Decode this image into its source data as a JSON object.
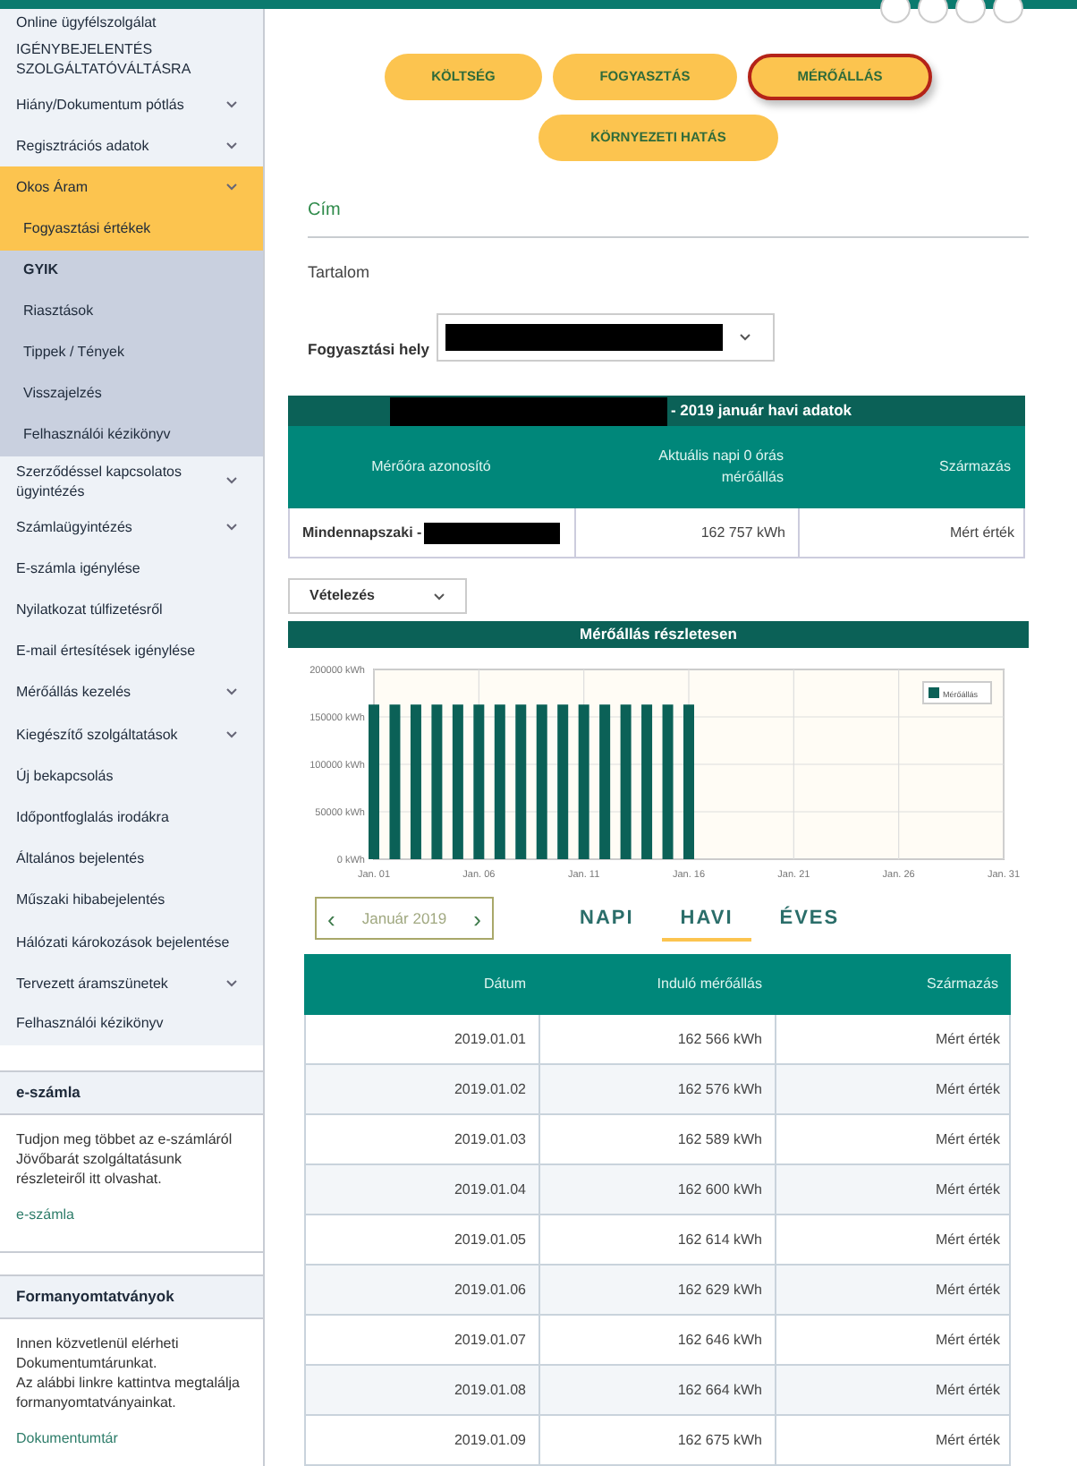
{
  "sidebar": {
    "items": [
      {
        "label": "Online ügyfélszolgálat",
        "expandable": false
      },
      {
        "label": "IGÉNYBEJELENTÉS SZOLGÁLTATÓVÁLTÁSRA",
        "expandable": false
      },
      {
        "label": "Hiány/Dokumentum pótlás",
        "expandable": true
      },
      {
        "label": "Regisztrációs adatok",
        "expandable": true
      },
      {
        "label": "Okos Áram",
        "expandable": true,
        "expanded": true,
        "children": [
          {
            "label": "Fogyasztási értékek",
            "selected": true,
            "bold": false
          },
          {
            "label": "GYIK",
            "selected": false,
            "bold": true
          },
          {
            "label": "Riasztások",
            "selected": false,
            "bold": false
          },
          {
            "label": "Tippek / Tények",
            "selected": false,
            "bold": false
          },
          {
            "label": "Visszajelzés",
            "selected": false,
            "bold": false
          },
          {
            "label": "Felhasználói kézikönyv",
            "selected": false,
            "bold": false
          }
        ]
      },
      {
        "label": "Szerződéssel kapcsolatos ügyintézés",
        "expandable": true
      },
      {
        "label": "Számlaügyintézés",
        "expandable": true
      },
      {
        "label": "E-számla igénylése",
        "expandable": false
      },
      {
        "label": "Nyilatkozat túlfizetésről",
        "expandable": false
      },
      {
        "label": "E-mail értesítések igénylése",
        "expandable": false
      },
      {
        "label": "Mérőállás kezelés",
        "expandable": true
      },
      {
        "label": "Kiegészítő szolgáltatások",
        "expandable": true
      },
      {
        "label": "Új bekapcsolás",
        "expandable": false
      },
      {
        "label": "Időpontfoglalás irodákra",
        "expandable": false
      },
      {
        "label": "Általános bejelentés",
        "expandable": false
      },
      {
        "label": "Műszaki hibabejelentés",
        "expandable": false
      },
      {
        "label": "Hálózati károkozások bejelentése",
        "expandable": false
      },
      {
        "label": "Tervezett áramszünetek",
        "expandable": true
      },
      {
        "label": "Felhasználói kézikönyv",
        "expandable": false
      }
    ],
    "boxes": [
      {
        "title": "e-számla",
        "text": [
          "Tudjon meg többet az e-számláról Jövőbarát szolgáltatásunk részleteiről itt olvashat."
        ],
        "link": "e-számla"
      },
      {
        "title": "Formanyomtatványok",
        "text": [
          "Innen közvetlenül elérheti Dokumentumtárunkat.",
          "Az alábbi linkre kattintva megtalálja formanyomtatványainkat."
        ],
        "link": "Dokumentumtár"
      }
    ]
  },
  "view_tabs": [
    {
      "label": "KÖLTSÉG",
      "selected": false
    },
    {
      "label": "FOGYASZTÁS",
      "selected": false
    },
    {
      "label": "MÉRŐÁLLÁS",
      "selected": true
    },
    {
      "label": "KÖRNYEZETI HATÁS",
      "selected": false
    }
  ],
  "cim": "Cím",
  "tartalom": "Tartalom",
  "place_label": "Fogyasztási hely",
  "meter_table": {
    "title": "- 2019 január havi adatok",
    "columns": [
      "Mérőóra azonosító",
      "Aktuális napi 0 órás mérőállás",
      "Származás"
    ],
    "row": [
      "Mindennapszaki -",
      "162 757 kWh",
      "Mért érték"
    ]
  },
  "direction_select": "Vételezés",
  "chart_title": "Mérőállás részletesen",
  "chart_data": {
    "type": "bar",
    "grid": true,
    "categories": [
      "Jan. 01",
      null,
      null,
      null,
      null,
      "Jan. 06",
      null,
      null,
      null,
      null,
      "Jan. 11",
      null,
      null,
      null,
      null,
      "Jan. 16",
      null,
      null,
      null,
      null,
      "Jan. 21",
      null,
      null,
      null,
      null,
      "Jan. 26",
      null,
      null,
      null,
      null,
      "Jan. 31"
    ],
    "series": [
      {
        "name": "Mérőállás",
        "color": "#0b6157",
        "values": [
          163000,
          163000,
          163000,
          163000,
          163000,
          163000,
          163000,
          163000,
          163000,
          163000,
          163000,
          163000,
          163000,
          163000,
          163000,
          163000,
          null,
          null,
          null,
          null,
          null,
          null,
          null,
          null,
          null,
          null,
          null,
          null,
          null,
          null,
          null
        ]
      }
    ],
    "ylim": [
      0,
      200000
    ],
    "yticks": [
      {
        "value": 0,
        "label": "0 kWh"
      },
      {
        "value": 50000,
        "label": "50000 kWh"
      },
      {
        "value": 100000,
        "label": "100000 kWh"
      },
      {
        "value": 150000,
        "label": "150000 kWh"
      },
      {
        "value": 200000,
        "label": "200000 kWh"
      }
    ]
  },
  "month_nav": {
    "label": "Január 2019",
    "prev": "‹",
    "next": "›"
  },
  "period_tabs": [
    {
      "label": "NAPI",
      "selected": false
    },
    {
      "label": "HAVI",
      "selected": true
    },
    {
      "label": "ÉVES",
      "selected": false
    }
  ],
  "daily_table": {
    "columns": [
      "Dátum",
      "Induló mérőállás",
      "Származás"
    ],
    "rows": [
      [
        "2019.01.01",
        "162 566 kWh",
        "Mért érték"
      ],
      [
        "2019.01.02",
        "162 576 kWh",
        "Mért érték"
      ],
      [
        "2019.01.03",
        "162 589 kWh",
        "Mért érték"
      ],
      [
        "2019.01.04",
        "162 600 kWh",
        "Mért érték"
      ],
      [
        "2019.01.05",
        "162 614 kWh",
        "Mért érték"
      ],
      [
        "2019.01.06",
        "162 629 kWh",
        "Mért érték"
      ],
      [
        "2019.01.07",
        "162 646 kWh",
        "Mért érték"
      ],
      [
        "2019.01.08",
        "162 664 kWh",
        "Mért érték"
      ],
      [
        "2019.01.09",
        "162 675 kWh",
        "Mért érték"
      ]
    ]
  }
}
